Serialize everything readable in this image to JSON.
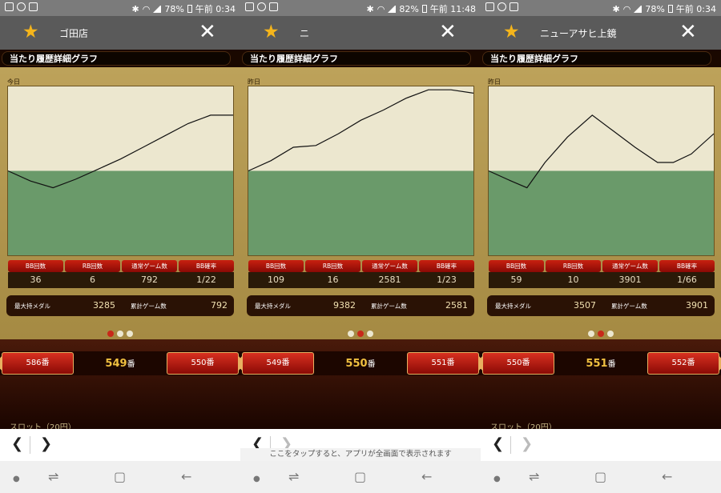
{
  "panels": [
    {
      "status": {
        "battery": "78%",
        "time": "午前 0:34"
      },
      "title": "ゴ田店",
      "section_header": "当たり履歴詳細グラフ",
      "day_label": "今日",
      "stats_headers": [
        "BB回数",
        "RB回数",
        "通常ゲーム数",
        "BB確率"
      ],
      "stats_values": [
        "36",
        "6",
        "792",
        "1/22"
      ],
      "max_medal_label": "最大持メダル",
      "max_medal": "3285",
      "total_games_label": "累計ゲーム数",
      "total_games": "792",
      "active_dot": 0,
      "prev_label": "586番",
      "current_num": "549",
      "current_suffix": "番",
      "next_label": "550番",
      "slot_label": "スロット（20円）",
      "forward_disabled": false,
      "hint": "",
      "chart_data": {
        "type": "line",
        "baseline_fraction": 0.5,
        "x": [
          0,
          10,
          20,
          30,
          40,
          50,
          60,
          70,
          80,
          90,
          100
        ],
        "y": [
          0.0,
          -0.06,
          -0.1,
          -0.05,
          0.01,
          0.07,
          0.14,
          0.21,
          0.28,
          0.33,
          0.33
        ]
      }
    },
    {
      "status": {
        "battery": "82%",
        "time": "午前 11:48"
      },
      "title": "ニ",
      "section_header": "当たり履歴詳細グラフ",
      "day_label": "昨日",
      "stats_headers": [
        "BB回数",
        "RB回数",
        "通常ゲーム数",
        "BB確率"
      ],
      "stats_values": [
        "109",
        "16",
        "2581",
        "1/23"
      ],
      "max_medal_label": "最大持メダル",
      "max_medal": "9382",
      "total_games_label": "累計ゲーム数",
      "total_games": "2581",
      "active_dot": 1,
      "prev_label": "549番",
      "current_num": "550",
      "current_suffix": "番",
      "next_label": "551番",
      "slot_label": "",
      "forward_disabled": true,
      "hint": "ここをタップすると、アプリが全画面で表示されます",
      "chart_data": {
        "type": "line",
        "baseline_fraction": 0.5,
        "x": [
          0,
          10,
          20,
          30,
          40,
          50,
          60,
          70,
          80,
          90,
          100
        ],
        "y": [
          0.0,
          0.06,
          0.14,
          0.15,
          0.22,
          0.3,
          0.36,
          0.43,
          0.48,
          0.48,
          0.46
        ]
      }
    },
    {
      "status": {
        "battery": "78%",
        "time": "午前 0:34"
      },
      "title": "ニューアサヒ上鏡",
      "section_header": "当たり履歴詳細グラフ",
      "day_label": "昨日",
      "stats_headers": [
        "BB回数",
        "RB回数",
        "通常ゲーム数",
        "BB確率"
      ],
      "stats_values": [
        "59",
        "10",
        "3901",
        "1/66"
      ],
      "max_medal_label": "最大持メダル",
      "max_medal": "3507",
      "total_games_label": "累計ゲーム数",
      "total_games": "3901",
      "active_dot": 1,
      "prev_label": "550番",
      "current_num": "551",
      "current_suffix": "番",
      "next_label": "552番",
      "slot_label": "スロット（20円）",
      "forward_disabled": true,
      "hint": "",
      "chart_data": {
        "type": "line",
        "baseline_fraction": 0.5,
        "x": [
          0,
          10,
          17,
          25,
          35,
          46,
          55,
          65,
          75,
          82,
          90,
          100
        ],
        "y": [
          0.0,
          -0.06,
          -0.1,
          0.05,
          0.2,
          0.33,
          0.24,
          0.14,
          0.05,
          0.05,
          0.1,
          0.22
        ]
      }
    }
  ]
}
